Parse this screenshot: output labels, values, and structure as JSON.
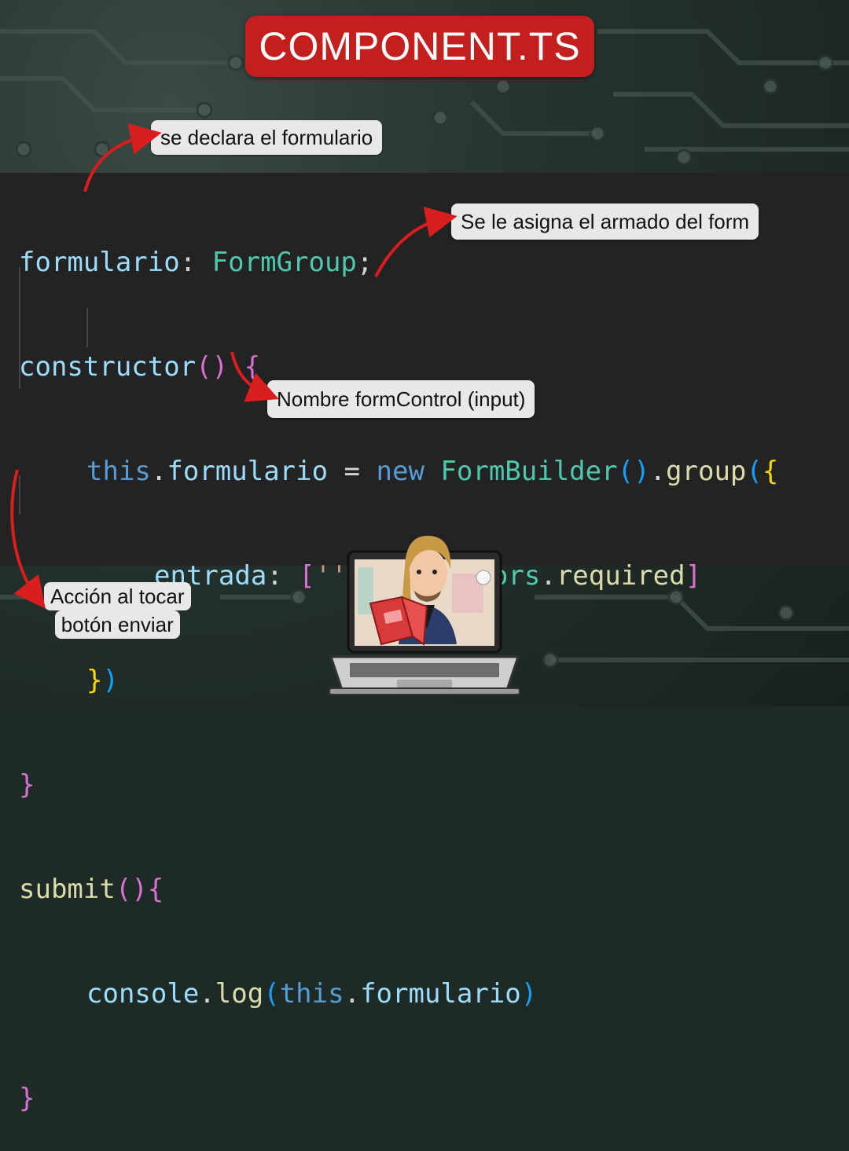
{
  "title": "COMPONENT.TS",
  "code": {
    "l1": {
      "a": "formulario",
      "b": ": ",
      "c": "FormGroup",
      "d": ";"
    },
    "l2": {
      "a": "constructor",
      "b": "(",
      "c": ")",
      "d": " ",
      "e": "{"
    },
    "l3": {
      "a": "this",
      "b": ".",
      "c": "formulario",
      "d": " = ",
      "e": "new",
      "f": " ",
      "g": "FormBuilder",
      "h": "(",
      "i": ")",
      "j": ".",
      "k": "group",
      "l": "(",
      "m": "{"
    },
    "l4": {
      "a": "entrada",
      "b": ": ",
      "c": "[",
      "d": "''",
      "e": ", ",
      "f": "Validators",
      "g": ".",
      "h": "required",
      "i": "]"
    },
    "l5": {
      "a": "}",
      "b": ")"
    },
    "l6": {
      "a": "}"
    },
    "l7": {
      "a": "submit",
      "b": "(",
      "c": ")",
      "d": "{"
    },
    "l8": {
      "a": "console",
      "b": ".",
      "c": "log",
      "d": "(",
      "e": "this",
      "f": ".",
      "g": "formulario",
      "h": ")"
    },
    "l9": {
      "a": "}"
    }
  },
  "annotations": {
    "declare": "se declara el formulario",
    "assign": "Se le asigna el armado del form",
    "name": "Nombre formControl (input)",
    "action_line1": "Acción al tocar",
    "action_line2": "botón enviar"
  },
  "colors": {
    "title_bg": "#c41f1f",
    "code_bg": "#232323",
    "arrow": "#d81e1e",
    "note_bg": "#e8e8e8"
  }
}
